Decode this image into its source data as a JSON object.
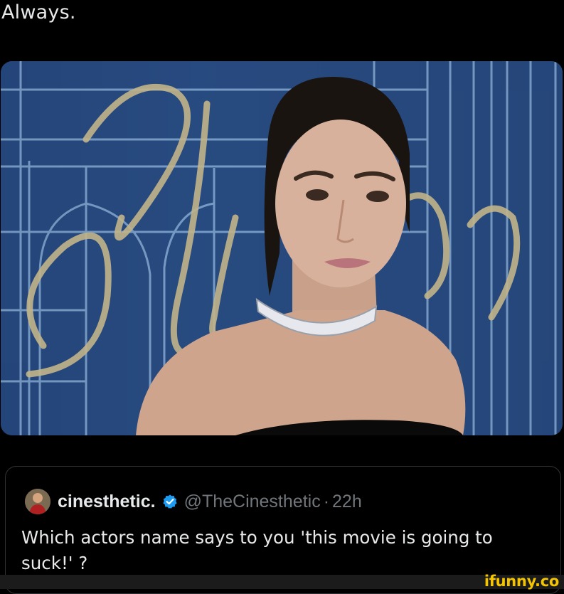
{
  "post": {
    "caption": "Always."
  },
  "photo": {
    "backdrop_color": "#2a4f86",
    "logo_color": "#c2b48a"
  },
  "quoted_tweet": {
    "display_name": "cinesthetic.",
    "handle": "@TheCinesthetic",
    "separator": "·",
    "time": "22h",
    "verified": true,
    "text": "Which actors name says to you 'this movie is going to suck!' ?"
  },
  "watermark": {
    "text": "ifunny.co"
  }
}
